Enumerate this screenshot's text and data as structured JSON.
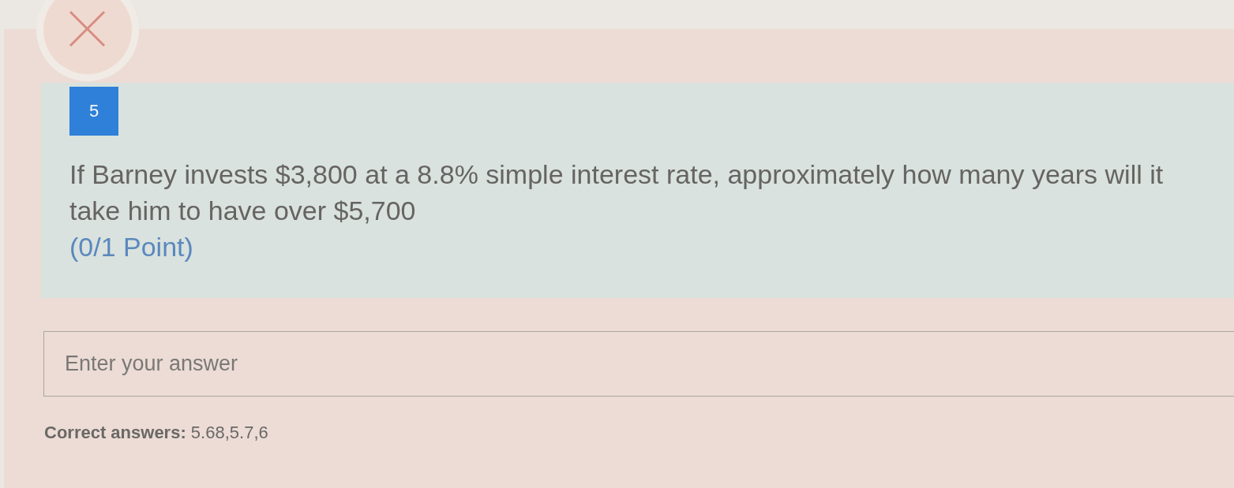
{
  "question": {
    "correct": false,
    "number": "5",
    "text": "If Barney invests $3,800 at a 8.8% simple interest rate, approximately how many years will it take him to have over $5,700",
    "points": "(0/1 Point)"
  },
  "answer_field": {
    "placeholder": "Enter your answer"
  },
  "correct_answers": {
    "text": "**Correct answers:** 5.68,5.7,6"
  }
}
